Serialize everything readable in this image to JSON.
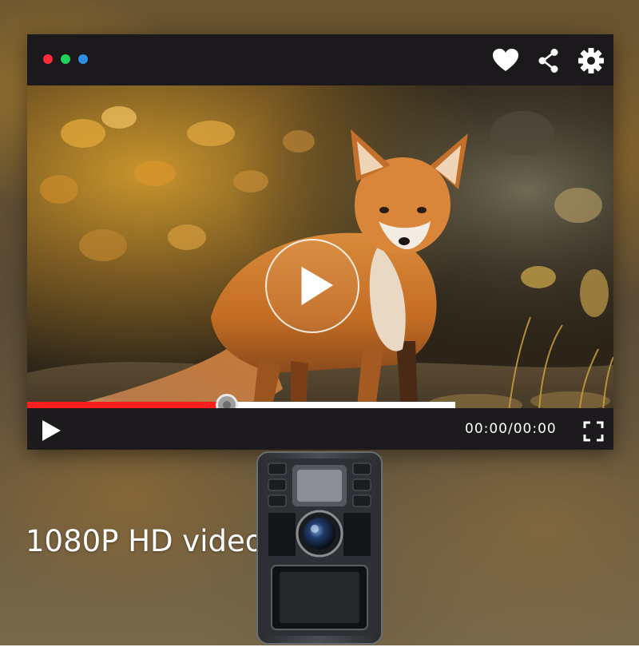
{
  "window": {
    "traffic_lights": [
      {
        "name": "close",
        "color": "#ff2a3a"
      },
      {
        "name": "minimize",
        "color": "#22d35a"
      },
      {
        "name": "maximize",
        "color": "#2f8fe6"
      }
    ],
    "toolbar_icons": [
      "heart-icon",
      "share-icon",
      "gear-icon"
    ]
  },
  "video": {
    "subject": "red fox in autumn foliage",
    "center_icon": "play-icon"
  },
  "playback": {
    "progress_fraction": 0.34,
    "buffered_fraction": 0.73,
    "progress_color": "#ff1e1e",
    "buffer_color": "#ffffff",
    "time_display": "00:00/00:00"
  },
  "controls": {
    "play_icon": "play-icon",
    "fullscreen_icon": "fullscreen-icon"
  },
  "caption": {
    "text": "1080P HD video"
  },
  "product": {
    "name": "trail camera",
    "body_color": "#3a3d42"
  }
}
